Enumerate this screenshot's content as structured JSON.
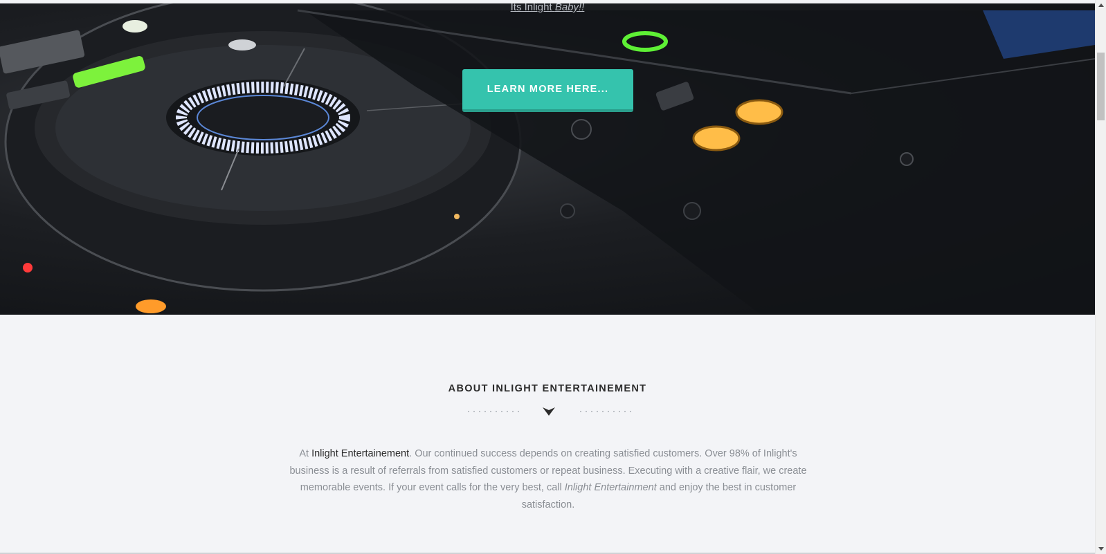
{
  "hero": {
    "tagline_prefix": "Its Inlight",
    "tagline_emph": "Baby!!",
    "cta_label": "LEARN MORE HERE..."
  },
  "about": {
    "title": "ABOUT INLIGHT ENTERTAINEMENT",
    "text_lead": "At ",
    "brand": "Inlight Entertainement",
    "text_mid": ". Our continued success depends on creating satisfied customers. Over 98% of Inlight's business is a result of referrals from satisfied customers or repeat business. Executing with a creative flair, we create memorable events. If your event calls for the very best, call ",
    "brand_italic": "Inlight Entertainment",
    "text_end": " and enjoy the best in customer satisfaction."
  },
  "colors": {
    "accent": "#35c3ad",
    "page_bg": "#f3f4f7",
    "heading": "#2b2b2b",
    "body_text": "#8a8e94"
  },
  "icons": {
    "divider": "chevron-down-icon"
  }
}
